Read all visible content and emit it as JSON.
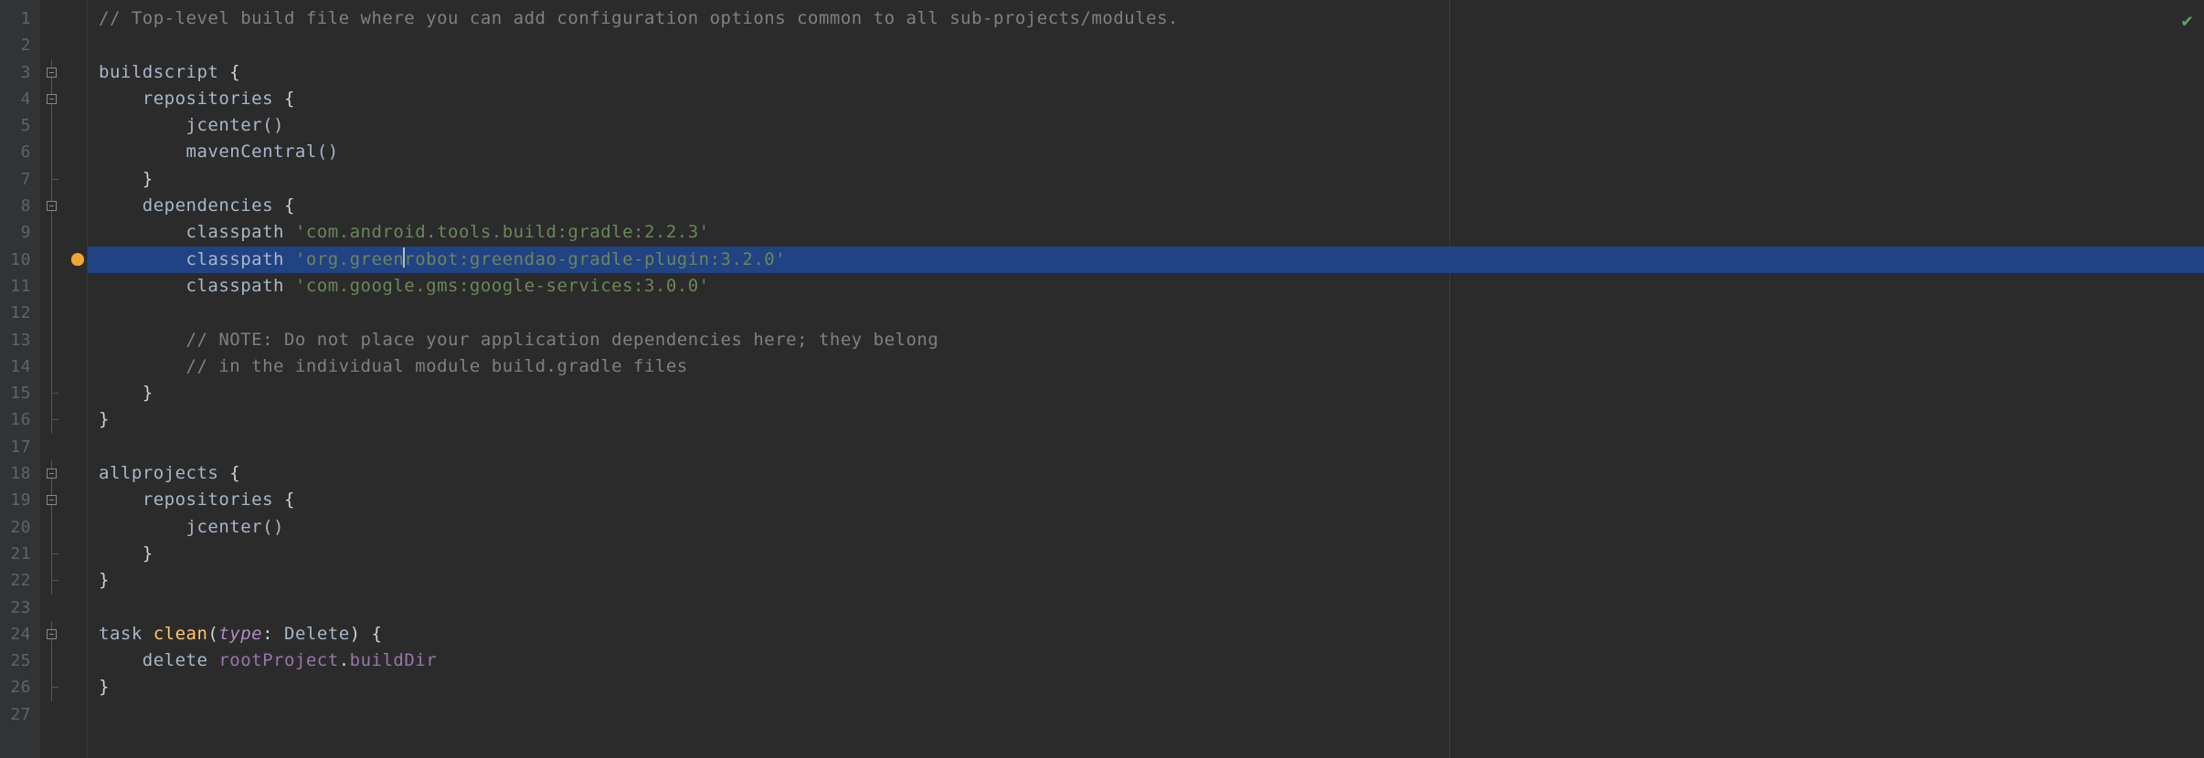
{
  "gutter": {
    "lines": [
      "1",
      "2",
      "3",
      "4",
      "5",
      "6",
      "7",
      "8",
      "9",
      "10",
      "11",
      "12",
      "13",
      "14",
      "15",
      "16",
      "17",
      "18",
      "19",
      "20",
      "21",
      "22",
      "23",
      "24",
      "25",
      "26",
      "27"
    ]
  },
  "code": {
    "l1_comment": "// Top-level build file where you can add configuration options common to all sub-projects/modules.",
    "l3_kw": "buildscript ",
    "l3_brace": "{",
    "l4_kw": "repositories ",
    "l4_brace": "{",
    "l5_fn": "jcenter()",
    "l6_fn": "mavenCentral()",
    "l7_brace": "}",
    "l8_kw": "dependencies ",
    "l8_brace": "{",
    "l9_kw": "classpath ",
    "l9_str": "'com.android.tools.build:gradle:2.2.3'",
    "l10_kw": "classpath ",
    "l10_str_a": "'org.green",
    "l10_str_b": "robot:greendao-gradle-plugin:3.2.0'",
    "l11_kw": "classpath ",
    "l11_str": "'com.google.gms:google-services:3.0.0'",
    "l13_comment": "// NOTE: Do not place your application dependencies here; they belong",
    "l14_comment": "// in the individual module build.gradle files",
    "l15_brace": "}",
    "l16_brace": "}",
    "l18_kw": "allprojects ",
    "l18_brace": "{",
    "l19_kw": "repositories ",
    "l19_brace": "{",
    "l20_fn": "jcenter()",
    "l21_brace": "}",
    "l22_brace": "}",
    "l24_task": "task ",
    "l24_name": "clean",
    "l24_paren_open": "(",
    "l24_type_label": "type",
    "l24_colon": ": ",
    "l24_delete": "Delete",
    "l24_paren_close": ") ",
    "l24_brace": "{",
    "l25_kw": "delete ",
    "l25_root": "rootProject",
    "l25_dot": ".",
    "l25_builddir": "buildDir",
    "l26_brace": "}"
  },
  "status": {
    "inspection_ok": "ok"
  }
}
